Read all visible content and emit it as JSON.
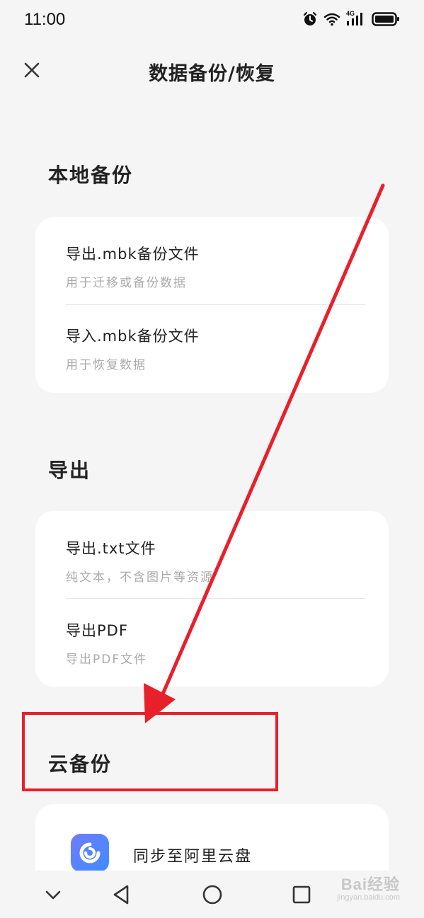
{
  "status_bar": {
    "time": "11:00",
    "network_label": "4G",
    "icons": [
      "alarm-icon",
      "wifi-icon",
      "signal-icon",
      "battery-icon"
    ]
  },
  "header": {
    "title": "数据备份/恢复",
    "close_icon": "close-icon"
  },
  "sections": {
    "local": {
      "title": "本地备份",
      "items": [
        {
          "title": "导出.mbk备份文件",
          "subtitle": "用于迁移或备份数据"
        },
        {
          "title": "导入.mbk备份文件",
          "subtitle": "用于恢复数据"
        }
      ]
    },
    "export": {
      "title": "导出",
      "items": [
        {
          "title": "导出.txt文件",
          "subtitle": "纯文本，不含图片等资源"
        },
        {
          "title": "导出PDF",
          "subtitle": "导出PDF文件"
        }
      ]
    },
    "cloud": {
      "title": "云备份",
      "items": [
        {
          "title": "同步至阿里云盘",
          "icon": "aliyun-drive-icon"
        }
      ]
    }
  },
  "nav_bar": {
    "icons": [
      "chevron-down-icon",
      "back-triangle-icon",
      "home-circle-icon",
      "recent-square-icon"
    ]
  },
  "annotation": {
    "color": "#e8202a"
  },
  "watermark": {
    "logo": "Bai经验",
    "domain": "jingyan.baidu.com"
  }
}
